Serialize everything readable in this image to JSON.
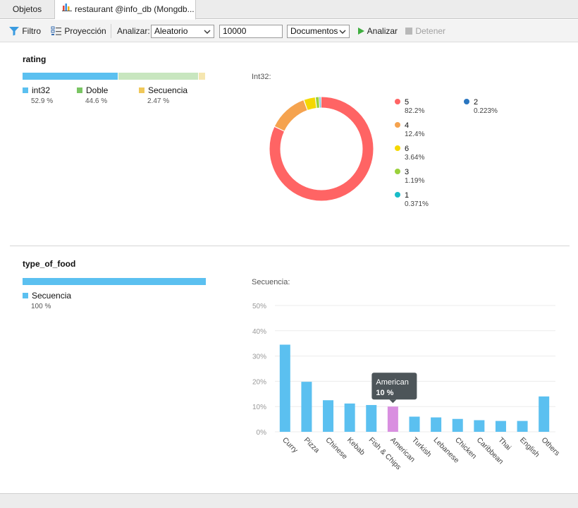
{
  "tabs": [
    {
      "label": "Objetos"
    },
    {
      "label": "restaurant @info_db (Mongdb..."
    }
  ],
  "toolbar": {
    "filter_label": "Filtro",
    "projection_label": "Proyección",
    "analyze_prefix": "Analizar:",
    "sample_mode": "Aleatorio",
    "sample_size": "10000",
    "sample_unit": "Documentos",
    "analyze_button": "Analizar",
    "stop_button": "Detener"
  },
  "fields": [
    {
      "name": "rating",
      "types": [
        {
          "label": "int32",
          "pct": "52.9 %",
          "fraction": 0.529,
          "color": "#5bc0f0"
        },
        {
          "label": "Doble",
          "pct": "44.6 %",
          "fraction": 0.446,
          "color": "#c8e6bf"
        },
        {
          "label": "Secuencia",
          "pct": "2.47 %",
          "fraction": 0.0247,
          "color": "#f5e6b0"
        }
      ],
      "legend_colors": [
        "#5bc0f0",
        "#7ac563",
        "#f0c85a"
      ],
      "detail_label": "Int32:"
    },
    {
      "name": "type_of_food",
      "types": [
        {
          "label": "Secuencia",
          "pct": "100 %",
          "fraction": 1.0,
          "color": "#5bc0f0"
        }
      ],
      "legend_colors": [
        "#5bc0f0"
      ],
      "detail_label": "Secuencia:"
    }
  ],
  "donut_legend": [
    {
      "label": "5",
      "pct": "82.2%",
      "value": 0.822,
      "color": "#ff6464"
    },
    {
      "label": "4",
      "pct": "12.4%",
      "value": 0.124,
      "color": "#f5a34f"
    },
    {
      "label": "6",
      "pct": "3.64%",
      "value": 0.0364,
      "color": "#f5d800"
    },
    {
      "label": "3",
      "pct": "1.19%",
      "value": 0.0119,
      "color": "#9ad13b"
    },
    {
      "label": "1",
      "pct": "0.371%",
      "value": 0.00371,
      "color": "#18bcc8"
    },
    {
      "label": "2",
      "pct": "0.223%",
      "value": 0.00223,
      "color": "#2a76c0"
    }
  ],
  "chart_data": {
    "type": "bar",
    "categories": [
      "Curry",
      "Pizza",
      "Chinese",
      "Kebab",
      "Fish & Chips",
      "American",
      "Turkish",
      "Lebanese",
      "Chicken",
      "Caribbean",
      "Thai",
      "English",
      "Others"
    ],
    "values": [
      34.5,
      19.8,
      12.5,
      11.2,
      10.6,
      10,
      6.0,
      5.7,
      5.1,
      4.6,
      4.3,
      4.3,
      14.0
    ],
    "ylim": [
      0,
      50
    ],
    "yticks": [
      "0%",
      "10%",
      "20%",
      "30%",
      "40%",
      "50%"
    ],
    "bar_color": "#5bc0f0",
    "highlight_color": "#d98fe0",
    "highlight_index": 5,
    "tooltip": {
      "title": "American",
      "value": "10 %"
    }
  }
}
